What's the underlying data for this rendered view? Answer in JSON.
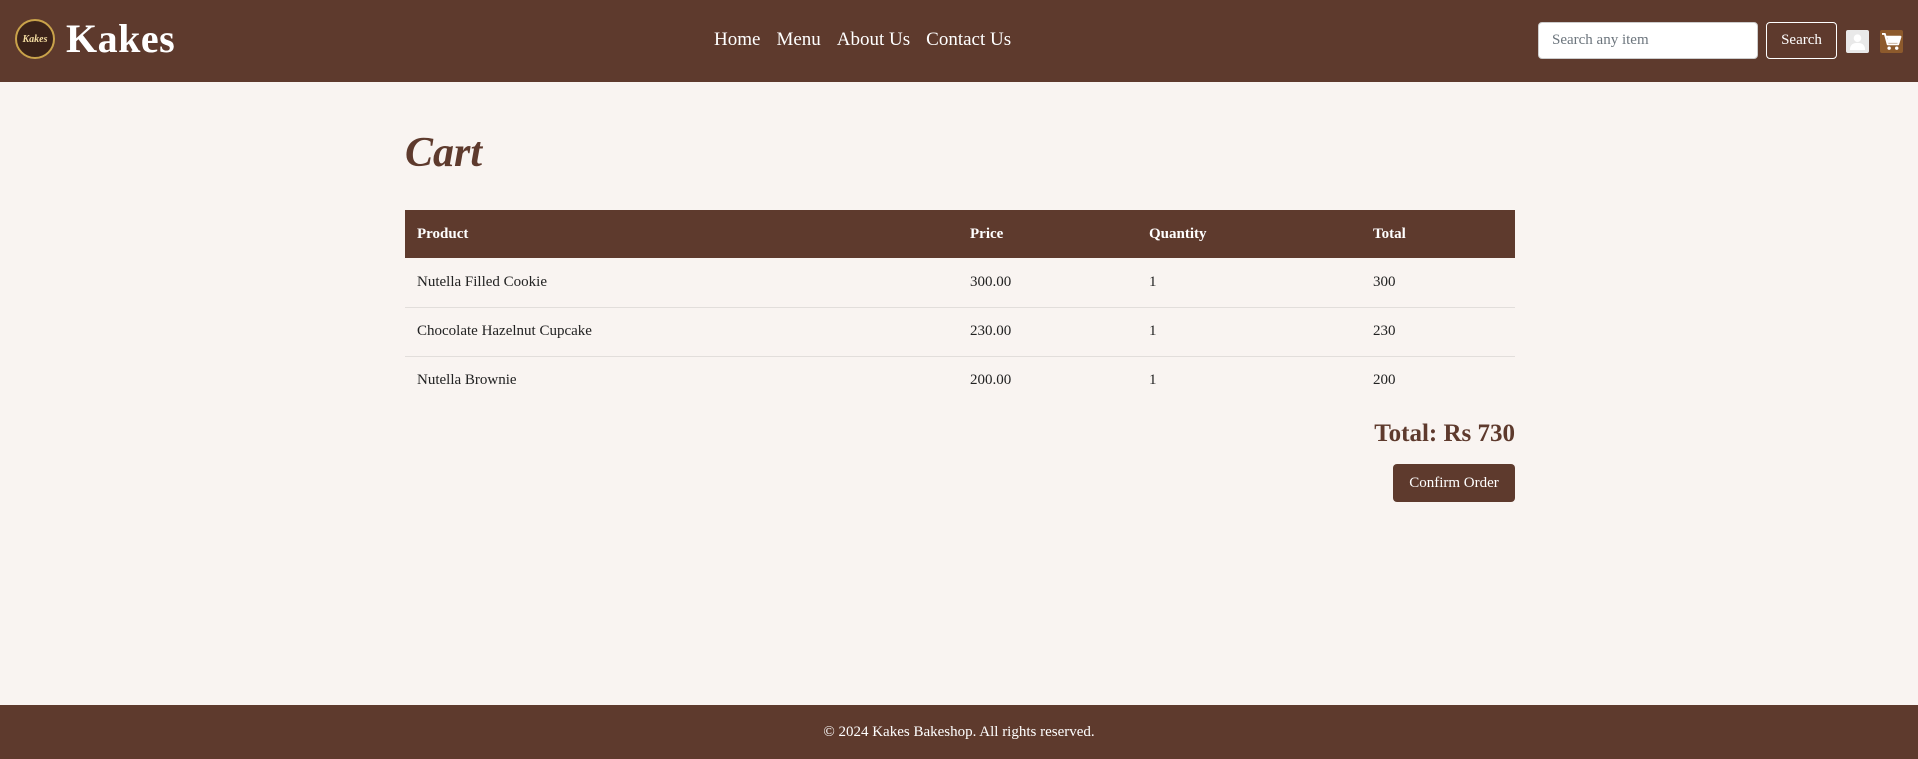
{
  "brand": {
    "name": "Kakes",
    "logo_text": "Kakes"
  },
  "nav": {
    "links": [
      {
        "label": "Home"
      },
      {
        "label": "Menu"
      },
      {
        "label": "About Us"
      },
      {
        "label": "Contact Us"
      }
    ]
  },
  "search": {
    "placeholder": "Search any item",
    "value": "",
    "button_label": "Search"
  },
  "icons": {
    "user": "user-icon",
    "cart": "cart-icon"
  },
  "cart": {
    "title": "Cart",
    "columns": [
      "Product",
      "Price",
      "Quantity",
      "Total"
    ],
    "rows": [
      {
        "product": "Nutella Filled Cookie",
        "price": "300.00",
        "quantity": "1",
        "total": "300"
      },
      {
        "product": "Chocolate Hazelnut Cupcake",
        "price": "230.00",
        "quantity": "1",
        "total": "230"
      },
      {
        "product": "Nutella Brownie",
        "price": "200.00",
        "quantity": "1",
        "total": "200"
      }
    ],
    "total_text": "Total: Rs 730",
    "confirm_label": "Confirm Order"
  },
  "footer": {
    "text": "© 2024 Kakes Bakeshop. All rights reserved."
  },
  "colors": {
    "brand": "#5e3a2d",
    "background": "#f9f4f1",
    "logo_ring": "#c9a24a"
  }
}
